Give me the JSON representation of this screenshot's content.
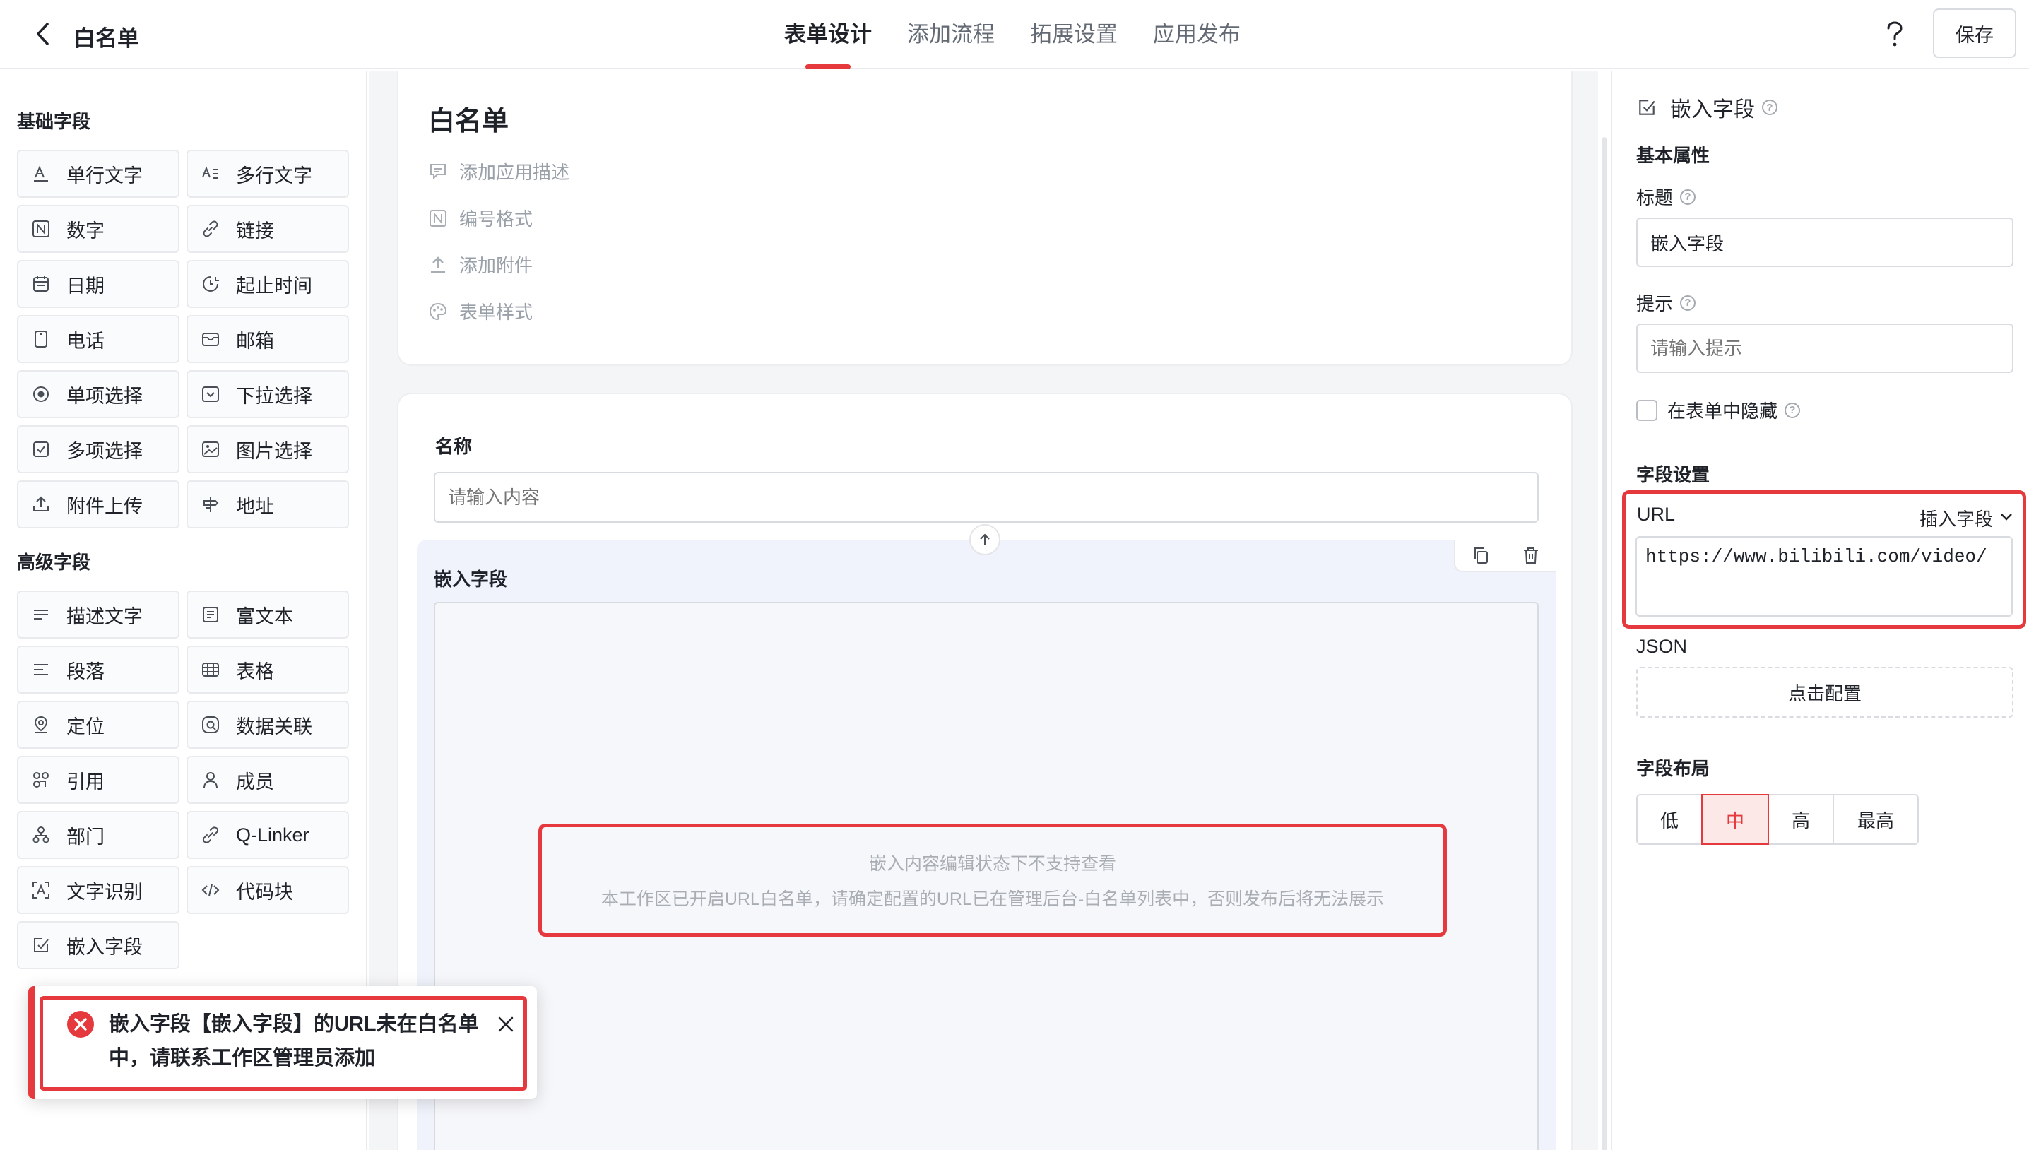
{
  "header": {
    "title": "白名单",
    "tabs": [
      {
        "label": "表单设计",
        "active": true
      },
      {
        "label": "添加流程",
        "active": false
      },
      {
        "label": "拓展设置",
        "active": false
      },
      {
        "label": "应用发布",
        "active": false
      }
    ],
    "help_icon": "question-mark-icon",
    "save_label": "保存"
  },
  "left_panel": {
    "basic_title": "基础字段",
    "basic_fields": [
      {
        "label": "单行文字",
        "icon": "single-line-text-icon"
      },
      {
        "label": "多行文字",
        "icon": "multi-line-text-icon"
      },
      {
        "label": "数字",
        "icon": "number-icon"
      },
      {
        "label": "链接",
        "icon": "link-icon"
      },
      {
        "label": "日期",
        "icon": "calendar-icon"
      },
      {
        "label": "起止时间",
        "icon": "time-range-icon"
      },
      {
        "label": "电话",
        "icon": "phone-icon"
      },
      {
        "label": "邮箱",
        "icon": "mail-icon"
      },
      {
        "label": "单项选择",
        "icon": "radio-icon"
      },
      {
        "label": "下拉选择",
        "icon": "dropdown-icon"
      },
      {
        "label": "多项选择",
        "icon": "checkbox-icon"
      },
      {
        "label": "图片选择",
        "icon": "image-icon"
      },
      {
        "label": "附件上传",
        "icon": "upload-icon"
      },
      {
        "label": "地址",
        "icon": "address-icon"
      }
    ],
    "advanced_title": "高级字段",
    "advanced_fields": [
      {
        "label": "描述文字",
        "icon": "description-icon"
      },
      {
        "label": "富文本",
        "icon": "rich-text-icon"
      },
      {
        "label": "段落",
        "icon": "paragraph-icon"
      },
      {
        "label": "表格",
        "icon": "table-icon"
      },
      {
        "label": "定位",
        "icon": "location-icon"
      },
      {
        "label": "数据关联",
        "icon": "data-link-icon"
      },
      {
        "label": "引用",
        "icon": "reference-icon"
      },
      {
        "label": "成员",
        "icon": "member-icon"
      },
      {
        "label": "部门",
        "icon": "department-icon"
      },
      {
        "label": "Q-Linker",
        "icon": "q-linker-icon"
      },
      {
        "label": "文字识别",
        "icon": "ocr-icon"
      },
      {
        "label": "代码块",
        "icon": "code-icon"
      },
      {
        "label": "嵌入字段",
        "icon": "embed-icon"
      }
    ]
  },
  "canvas": {
    "form_title": "白名单",
    "meta": [
      {
        "label": "添加应用描述",
        "icon": "comment-icon"
      },
      {
        "label": "编号格式",
        "icon": "number-format-icon"
      },
      {
        "label": "添加附件",
        "icon": "attachment-upload-icon"
      },
      {
        "label": "表单样式",
        "icon": "palette-icon"
      }
    ],
    "name_label": "名称",
    "name_placeholder": "请输入内容",
    "embed_label": "嵌入字段",
    "notice_line1": "嵌入内容编辑状态下不支持查看",
    "notice_line2": "本工作区已开启URL白名单，请确定配置的URL已在管理后台-白名单列表中，否则发布后将无法展示"
  },
  "right_panel": {
    "title": "嵌入字段",
    "basic_section": "基本属性",
    "title_label": "标题",
    "title_value": "嵌入字段",
    "hint_label": "提示",
    "hint_placeholder": "请输入提示",
    "hide_label": "在表单中隐藏",
    "field_settings_section": "字段设置",
    "url_label": "URL",
    "insert_field_label": "插入字段",
    "url_value": "https://www.bilibili.com/video/",
    "json_label": "JSON",
    "config_label": "点击配置",
    "layout_section": "字段布局",
    "layout_options": [
      {
        "label": "低",
        "active": false
      },
      {
        "label": "中",
        "active": true
      },
      {
        "label": "高",
        "active": false
      },
      {
        "label": "最高",
        "active": false
      }
    ]
  },
  "toast": {
    "message": "嵌入字段【嵌入字段】的URL未在白名单中，请联系工作区管理员添加",
    "icon": "error-circle-icon"
  },
  "colors": {
    "accent": "#e5393d",
    "text": "#1f2329",
    "muted": "#9aa0a8",
    "border": "#d8dbe0",
    "canvas_bg": "#f4f5f7"
  }
}
